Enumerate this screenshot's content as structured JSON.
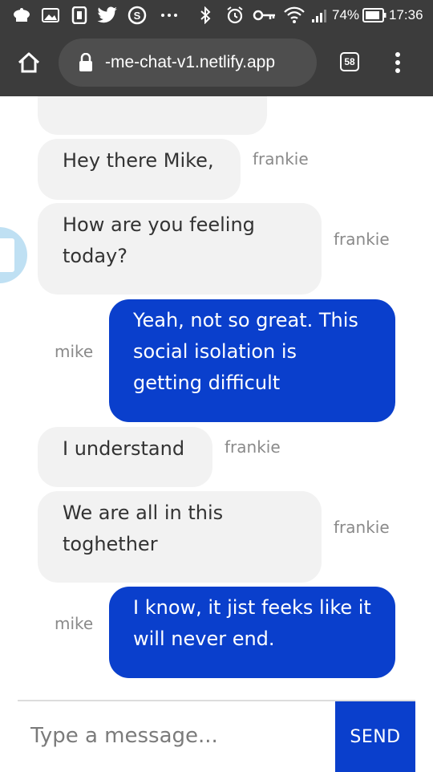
{
  "status_bar": {
    "battery_percent": "74%",
    "time": "17:36",
    "notification_icons": [
      "chef-hat-icon",
      "image-icon",
      "flipboard-icon",
      "twitter-icon",
      "skype-icon",
      "more-dots-icon"
    ],
    "system_icons": [
      "bluetooth-icon",
      "alarm-icon",
      "vpn-key-icon",
      "wifi-icon",
      "signal-icon",
      "battery-icon"
    ]
  },
  "browser": {
    "url": "‑me-chat-v1.netlify.app",
    "tab_count": "58"
  },
  "chat": {
    "messages": [
      {
        "sender": "frankie",
        "text": "Hey there Mike,",
        "direction": "incoming"
      },
      {
        "sender": "frankie",
        "text": "How are you feeling today?",
        "direction": "incoming"
      },
      {
        "sender": "mike",
        "text": "Yeah, not so great. This social isolation is getting difficult",
        "direction": "outgoing"
      },
      {
        "sender": "frankie",
        "text": "I understand",
        "direction": "incoming"
      },
      {
        "sender": "frankie",
        "text": "We are all in this toghether",
        "direction": "incoming"
      },
      {
        "sender": "mike",
        "text": "I know, it jist feeks like it will never end.",
        "direction": "outgoing"
      }
    ]
  },
  "composer": {
    "placeholder": "Type a message...",
    "send_label": "SEND"
  },
  "colors": {
    "outgoing_bubble": "#0a3fcc",
    "incoming_bubble": "#f2f2f2",
    "browser_chrome": "#3c3c3c"
  }
}
